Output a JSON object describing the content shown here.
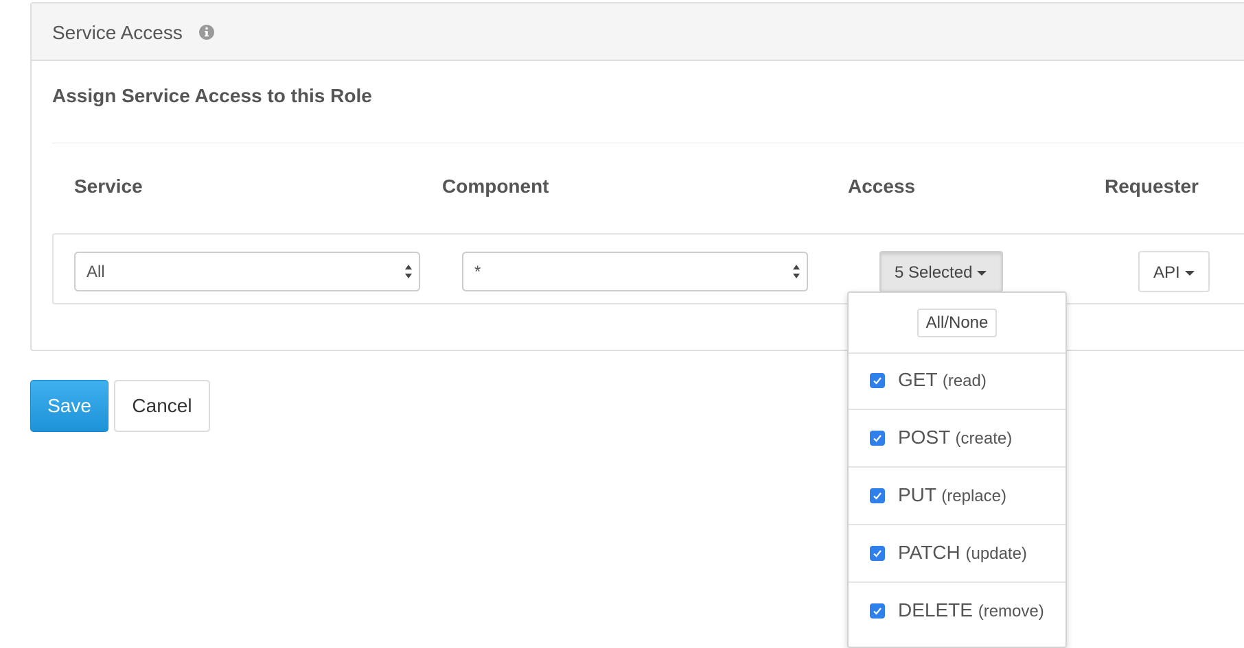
{
  "panel": {
    "title": "Service Access",
    "section_title": "Assign Service Access to this Role"
  },
  "columns": {
    "service": "Service",
    "component": "Component",
    "access": "Access",
    "requester": "Requester"
  },
  "row": {
    "service_value": "All",
    "component_value": "*",
    "access_label": "5 Selected",
    "requester_label": "API"
  },
  "actions": {
    "save": "Save",
    "cancel": "Cancel"
  },
  "access_dropdown": {
    "all_none": "All/None",
    "options": [
      {
        "method": "GET",
        "desc": "(read)",
        "checked": true
      },
      {
        "method": "POST",
        "desc": "(create)",
        "checked": true
      },
      {
        "method": "PUT",
        "desc": "(replace)",
        "checked": true
      },
      {
        "method": "PATCH",
        "desc": "(update)",
        "checked": true
      },
      {
        "method": "DELETE",
        "desc": "(remove)",
        "checked": true
      }
    ]
  },
  "colors": {
    "primary": "#2a9fe0",
    "checkbox": "#2f7fed",
    "header_bg": "#f5f5f5"
  },
  "icons": {
    "info": "info-circle-icon",
    "select_arrows": "sort-arrows-icon",
    "caret": "caret-down-icon",
    "check": "checkmark-icon"
  }
}
